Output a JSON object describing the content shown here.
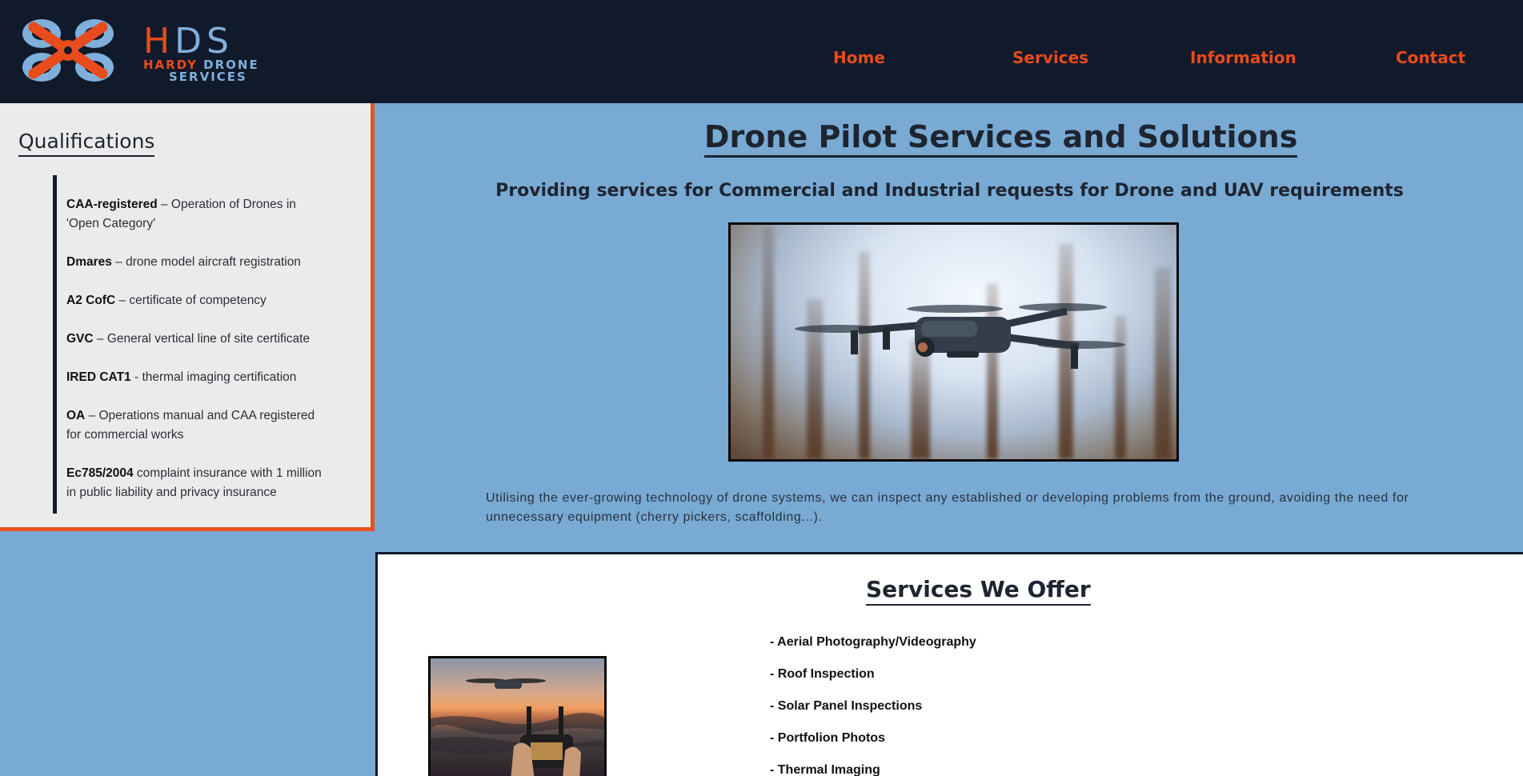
{
  "header": {
    "logo": {
      "big_letters": [
        "H",
        "DS"
      ],
      "line1_orange": "HARDY ",
      "line1_blue": "DRONE",
      "line2": "SERVICES"
    },
    "nav": [
      {
        "label": "Home"
      },
      {
        "label": "Services"
      },
      {
        "label": "Information"
      },
      {
        "label": "Contact"
      }
    ]
  },
  "sidebar": {
    "title": "Qualifications",
    "items": [
      {
        "bold": "CAA-registered",
        "text": " – Operation of Drones in 'Open Category'"
      },
      {
        "bold": "Dmares",
        "text": " – drone model aircraft registration"
      },
      {
        "bold": "A2 CofC",
        "text": " – certificate of competency"
      },
      {
        "bold": "GVC",
        "text": " – General vertical line of site certificate"
      },
      {
        "bold": "IRED CAT1",
        "text": " - thermal imaging certification"
      },
      {
        "bold": "OA",
        "text": " – Operations manual and CAA registered for commercial works"
      },
      {
        "bold": "Ec785/2004",
        "text": " complaint insurance with 1 million in public liability and privacy insurance"
      }
    ]
  },
  "hero": {
    "title": "Drone Pilot Services and Solutions",
    "subtitle": "Providing services for Commercial and Industrial requests for Drone and UAV requirements",
    "description": "Utilising the ever-growing technology of drone systems, we can inspect any established or developing problems from the ground, avoiding the need for unnecessary equipment (cherry pickers, scaffolding...)."
  },
  "services": {
    "title": "Services We Offer",
    "items": [
      "- Aerial Photography/Videography",
      "- Roof Inspection",
      "- Solar Panel Inspections",
      "- Portfolion Photos",
      "- Thermal Imaging"
    ]
  },
  "colors": {
    "header_bg": "#111a2b",
    "accent_orange": "#e84b1c",
    "page_bg": "#78aad3",
    "sidebar_bg": "#ebebeb"
  }
}
